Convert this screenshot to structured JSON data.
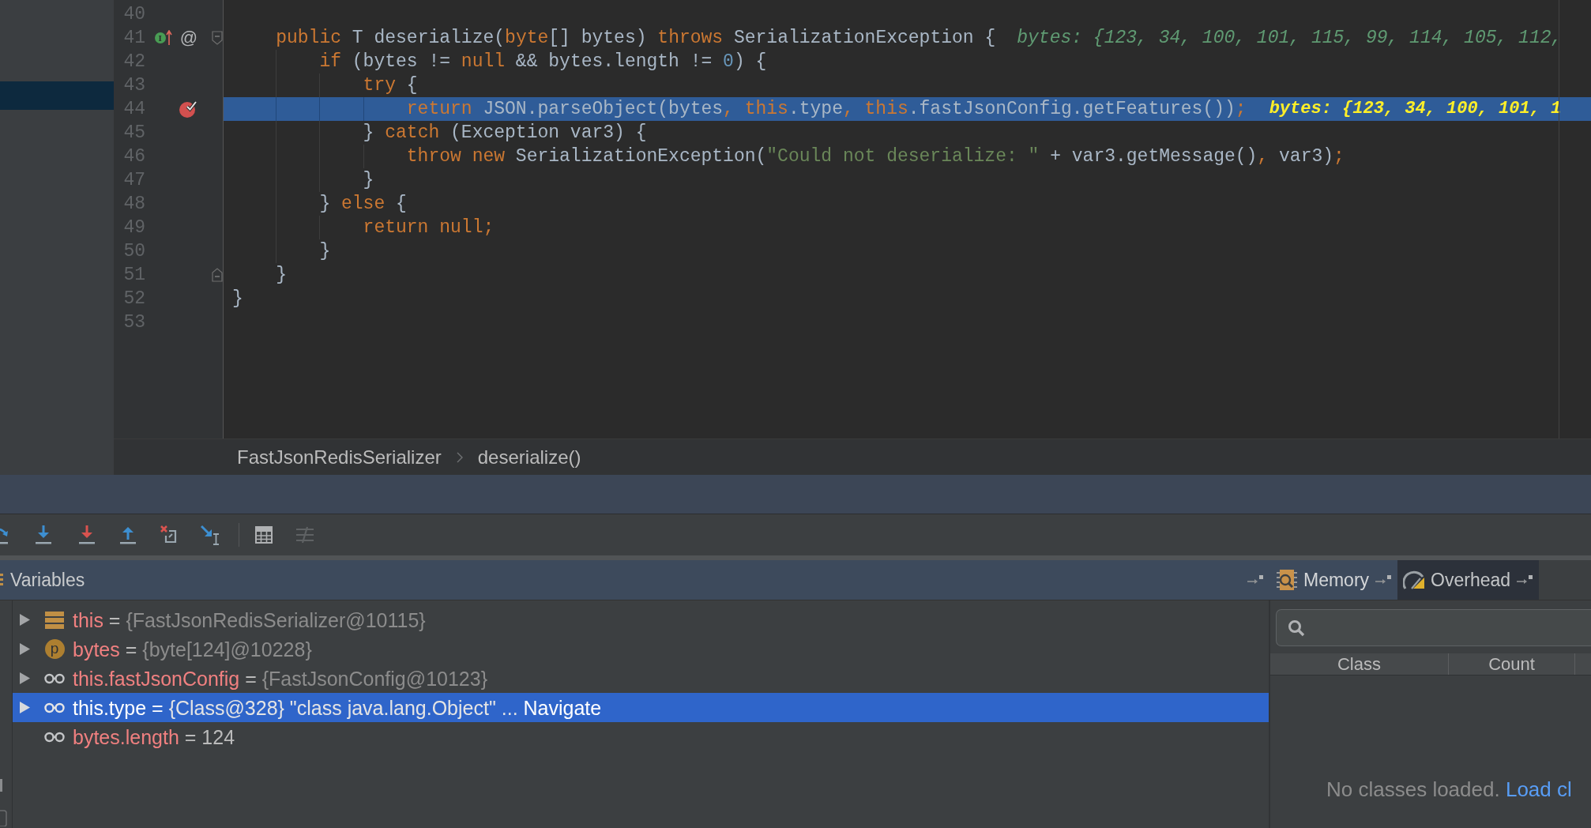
{
  "editor": {
    "lines": [
      {
        "number": "40",
        "current": false
      },
      {
        "number": "41",
        "current": false,
        "marks": [
          {
            "kind": "implements",
            "badge": "I"
          },
          {
            "kind": "annotation",
            "text": "@"
          },
          {
            "kind": "fold_start"
          }
        ],
        "tokens": [
          {
            "text": "    public",
            "kind": "keyword"
          },
          {
            "text": " T deserialize(",
            "kind": "plain"
          },
          {
            "text": "byte",
            "kind": "keyword"
          },
          {
            "text": "[] bytes) ",
            "kind": "plain"
          },
          {
            "text": "throws",
            "kind": "keyword"
          },
          {
            "text": " SerializationException {",
            "kind": "plain"
          }
        ],
        "hint": "bytes: {123, 34, 100, 101, 115, 99, 114, 105, 112,"
      },
      {
        "number": "42",
        "current": false,
        "tokens": [
          {
            "text": "        if",
            "kind": "keyword"
          },
          {
            "text": " (bytes != ",
            "kind": "plain"
          },
          {
            "text": "null",
            "kind": "keyword"
          },
          {
            "text": " && bytes.length != ",
            "kind": "plain"
          },
          {
            "text": "0",
            "kind": "number"
          },
          {
            "text": ") {",
            "kind": "plain"
          }
        ]
      },
      {
        "number": "43",
        "current": false,
        "tokens": [
          {
            "text": "            try",
            "kind": "keyword"
          },
          {
            "text": " {",
            "kind": "plain"
          }
        ]
      },
      {
        "number": "44",
        "current": true,
        "marks": [
          {
            "kind": "breakpoint"
          }
        ],
        "tokens": [
          {
            "text": "                return",
            "kind": "keyword"
          },
          {
            "text": " JSON.parseObject(bytes",
            "kind": "plain"
          },
          {
            "text": ", ",
            "kind": "keyword"
          },
          {
            "text": "this",
            "kind": "keyword"
          },
          {
            "text": ".type",
            "kind": "plain"
          },
          {
            "text": ", ",
            "kind": "keyword"
          },
          {
            "text": "this",
            "kind": "keyword"
          },
          {
            "text": ".fastJsonConfig.getFeatures())",
            "kind": "plain"
          },
          {
            "text": ";",
            "kind": "keyword"
          }
        ],
        "hint": "bytes: {123, 34, 100, 101, 1"
      },
      {
        "number": "45",
        "current": false,
        "tokens": [
          {
            "text": "            } ",
            "kind": "plain"
          },
          {
            "text": "catch",
            "kind": "keyword"
          },
          {
            "text": " (Exception var3) {",
            "kind": "plain"
          }
        ]
      },
      {
        "number": "46",
        "current": false,
        "tokens": [
          {
            "text": "                throw new",
            "kind": "keyword"
          },
          {
            "text": " SerializationException(",
            "kind": "plain"
          },
          {
            "text": "\"Could not deserialize: \"",
            "kind": "string"
          },
          {
            "text": " + var3.getMessage()",
            "kind": "plain"
          },
          {
            "text": ",",
            "kind": "keyword"
          },
          {
            "text": " var3)",
            "kind": "plain"
          },
          {
            "text": ";",
            "kind": "keyword"
          }
        ]
      },
      {
        "number": "47",
        "current": false,
        "tokens": [
          {
            "text": "            }",
            "kind": "plain"
          }
        ]
      },
      {
        "number": "48",
        "current": false,
        "tokens": [
          {
            "text": "        } ",
            "kind": "plain"
          },
          {
            "text": "else",
            "kind": "keyword"
          },
          {
            "text": " {",
            "kind": "plain"
          }
        ]
      },
      {
        "number": "49",
        "current": false,
        "tokens": [
          {
            "text": "            return null;",
            "kind": "keyword"
          }
        ]
      },
      {
        "number": "50",
        "current": false,
        "tokens": [
          {
            "text": "        }",
            "kind": "plain"
          }
        ]
      },
      {
        "number": "51",
        "current": false,
        "marks": [
          {
            "kind": "fold_end"
          }
        ],
        "tokens": [
          {
            "text": "    }",
            "kind": "plain"
          }
        ]
      },
      {
        "number": "52",
        "current": false,
        "tokens": [
          {
            "text": "}",
            "kind": "plain"
          }
        ]
      },
      {
        "number": "53",
        "current": false
      }
    ]
  },
  "breadcrumbs": [
    "FastJsonRedisSerializer",
    "deserialize()"
  ],
  "debugger": {
    "toolbar": [
      {
        "kind": "step_over",
        "disabled": false
      },
      {
        "kind": "step_into",
        "disabled": false
      },
      {
        "kind": "force_step_into",
        "disabled": false
      },
      {
        "kind": "step_out",
        "disabled": false
      },
      {
        "kind": "drop_frame",
        "disabled": false
      },
      {
        "kind": "run_to_cursor",
        "disabled": false
      },
      {
        "kind": "separator"
      },
      {
        "kind": "evaluate",
        "disabled": false
      },
      {
        "kind": "trace",
        "disabled": true
      }
    ],
    "variables": {
      "title": "Variables",
      "rows": [
        {
          "kind": "object",
          "name": "this",
          "op": "=",
          "value": "{FastJsonRedisSerializer@10115}",
          "value_dimmed": true,
          "expandable": true,
          "expanded": false,
          "selected": false
        },
        {
          "kind": "parameter",
          "badge": "p",
          "name": "bytes",
          "op": "=",
          "value": "{byte[124]@10228}",
          "value_dimmed": true,
          "expandable": true,
          "expanded": false,
          "selected": false
        },
        {
          "kind": "watch",
          "name": "this.fastJsonConfig",
          "op": "=",
          "value": "{FastJsonConfig@10123}",
          "value_dimmed": true,
          "expandable": true,
          "expanded": false,
          "selected": false
        },
        {
          "kind": "watch",
          "name": "this.type",
          "op": "=",
          "value": "{Class@328} \"class java.lang.Object\" ...",
          "link": "Navigate",
          "value_dimmed": true,
          "expandable": true,
          "expanded": false,
          "selected": true
        },
        {
          "kind": "watch",
          "name": "bytes.length",
          "op": "=",
          "value": "124",
          "value_dimmed": false,
          "expandable": false,
          "selected": false
        }
      ]
    },
    "tabs": [
      {
        "kind": "memory",
        "label": "Memory",
        "selected": true,
        "hovered": false
      },
      {
        "kind": "overhead",
        "label": "Overhead",
        "selected": false,
        "hovered": true
      }
    ],
    "memory": {
      "columns": [
        "Class",
        "Count"
      ],
      "empty_text": "No classes loaded.",
      "link": "Load cl"
    }
  }
}
